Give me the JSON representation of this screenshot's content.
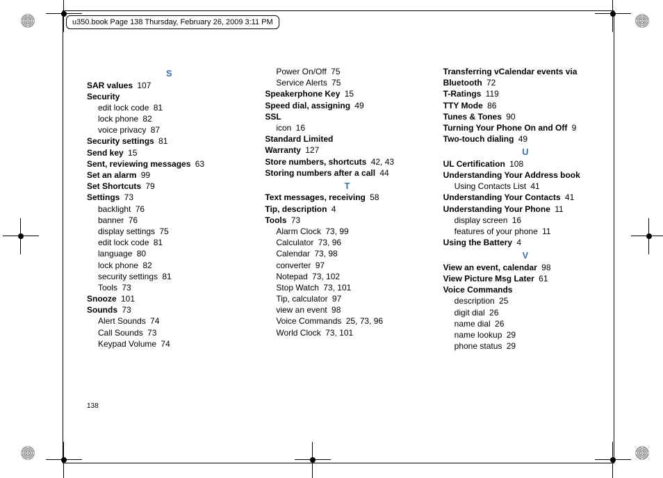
{
  "header_text": "u350.book  Page 138  Thursday, February 26, 2009  3:11 PM",
  "page_number": "138",
  "columns": [
    [
      {
        "type": "letter",
        "text": "S"
      },
      {
        "type": "entry",
        "bold": true,
        "text": "SAR values",
        "pages": "107"
      },
      {
        "type": "entry",
        "bold": true,
        "text": "Security",
        "pages": ""
      },
      {
        "type": "sub",
        "text": "edit lock code",
        "pages": "81"
      },
      {
        "type": "sub",
        "text": "lock phone",
        "pages": "82"
      },
      {
        "type": "sub",
        "text": "voice privacy",
        "pages": "87"
      },
      {
        "type": "entry",
        "bold": true,
        "text": "Security settings",
        "pages": "81"
      },
      {
        "type": "entry",
        "bold": true,
        "text": "Send key",
        "pages": "15"
      },
      {
        "type": "entry",
        "bold": true,
        "text": "Sent, reviewing messages",
        "pages": "63"
      },
      {
        "type": "entry",
        "bold": true,
        "text": "Set an alarm",
        "pages": "99"
      },
      {
        "type": "entry",
        "bold": true,
        "text": "Set Shortcuts",
        "pages": "79"
      },
      {
        "type": "entry",
        "bold": true,
        "text": "Settings",
        "pages": "73"
      },
      {
        "type": "sub",
        "text": "backlight",
        "pages": "76"
      },
      {
        "type": "sub",
        "text": "banner",
        "pages": "76"
      },
      {
        "type": "sub",
        "text": "display settings",
        "pages": "75"
      },
      {
        "type": "sub",
        "text": "edit lock code",
        "pages": "81"
      },
      {
        "type": "sub",
        "text": "language",
        "pages": "80"
      },
      {
        "type": "sub",
        "text": "lock phone",
        "pages": "82"
      },
      {
        "type": "sub",
        "text": "security settings",
        "pages": "81"
      },
      {
        "type": "sub",
        "text": "Tools",
        "pages": "73"
      },
      {
        "type": "entry",
        "bold": true,
        "text": "Snooze",
        "pages": "101"
      },
      {
        "type": "entry",
        "bold": true,
        "text": "Sounds",
        "pages": "73"
      },
      {
        "type": "sub",
        "text": "Alert Sounds",
        "pages": "74"
      },
      {
        "type": "sub",
        "text": "Call Sounds",
        "pages": "73"
      },
      {
        "type": "sub",
        "text": "Keypad Volume",
        "pages": "74"
      }
    ],
    [
      {
        "type": "sub",
        "text": "Power On/Off",
        "pages": "75"
      },
      {
        "type": "sub",
        "text": "Service Alerts",
        "pages": "75"
      },
      {
        "type": "entry",
        "bold": true,
        "text": "Speakerphone Key",
        "pages": "15"
      },
      {
        "type": "entry",
        "bold": true,
        "text": "Speed dial, assigning",
        "pages": "49"
      },
      {
        "type": "entry",
        "bold": true,
        "text": "SSL",
        "pages": ""
      },
      {
        "type": "sub",
        "text": "icon",
        "pages": "16"
      },
      {
        "type": "entry",
        "bold": true,
        "text": "Standard Limited",
        "pages": ""
      },
      {
        "type": "entry",
        "bold": true,
        "text": "Warranty",
        "pages": "127"
      },
      {
        "type": "entry",
        "bold": true,
        "text": "Store numbers, shortcuts",
        "pages": "42, 43"
      },
      {
        "type": "entry",
        "bold": true,
        "text": "Storing numbers after a call",
        "pages": "44"
      },
      {
        "type": "letter",
        "text": "T"
      },
      {
        "type": "entry",
        "bold": true,
        "text": "Text messages, receiving",
        "pages": "58"
      },
      {
        "type": "entry",
        "bold": true,
        "text": "Tip, description",
        "pages": "4"
      },
      {
        "type": "entry",
        "bold": true,
        "text": "Tools",
        "pages": "73"
      },
      {
        "type": "sub",
        "text": "Alarm Clock",
        "pages": "73, 99"
      },
      {
        "type": "sub",
        "text": "Calculator",
        "pages": "73, 96"
      },
      {
        "type": "sub",
        "text": "Calendar",
        "pages": "73, 98"
      },
      {
        "type": "sub",
        "text": "converter",
        "pages": "97"
      },
      {
        "type": "sub",
        "text": "Notepad",
        "pages": "73, 102"
      },
      {
        "type": "sub",
        "text": "Stop Watch",
        "pages": "73, 101"
      },
      {
        "type": "sub",
        "text": "Tip, calculator",
        "pages": "97"
      },
      {
        "type": "sub",
        "text": "view an event",
        "pages": "98"
      },
      {
        "type": "sub",
        "text": "Voice Commands",
        "pages": "25, 73, 96"
      },
      {
        "type": "sub",
        "text": "World Clock",
        "pages": "73, 101"
      }
    ],
    [
      {
        "type": "entry",
        "bold": true,
        "text": "Transferring vCalendar events via",
        "pages": ""
      },
      {
        "type": "entry",
        "bold": true,
        "text": "Bluetooth",
        "pages": "72"
      },
      {
        "type": "entry",
        "bold": true,
        "text": "T-Ratings",
        "pages": "119"
      },
      {
        "type": "entry",
        "bold": true,
        "text": "TTY Mode",
        "pages": "86"
      },
      {
        "type": "entry",
        "bold": true,
        "text": "Tunes & Tones",
        "pages": "90"
      },
      {
        "type": "entry",
        "bold": true,
        "text": "Turning Your Phone On and Off",
        "pages": "9"
      },
      {
        "type": "entry",
        "bold": true,
        "text": "Two-touch dialing",
        "pages": "49"
      },
      {
        "type": "letter",
        "text": "U"
      },
      {
        "type": "entry",
        "bold": true,
        "text": "UL Certification",
        "pages": "108"
      },
      {
        "type": "entry",
        "bold": true,
        "text": "Understanding Your Address book",
        "pages": ""
      },
      {
        "type": "sub",
        "text": "Using Contacts List",
        "pages": "41"
      },
      {
        "type": "entry",
        "bold": true,
        "text": "Understanding Your Contacts",
        "pages": "41"
      },
      {
        "type": "entry",
        "bold": true,
        "text": "Understanding Your Phone",
        "pages": "11"
      },
      {
        "type": "sub",
        "text": "display screen",
        "pages": "16"
      },
      {
        "type": "sub",
        "text": "features of your phone",
        "pages": "11"
      },
      {
        "type": "entry",
        "bold": true,
        "text": "Using the Battery",
        "pages": "4"
      },
      {
        "type": "letter",
        "text": "V"
      },
      {
        "type": "entry",
        "bold": true,
        "text": "View an event, calendar",
        "pages": "98"
      },
      {
        "type": "entry",
        "bold": true,
        "text": "View Picture Msg Later",
        "pages": "61"
      },
      {
        "type": "entry",
        "bold": true,
        "text": "Voice Commands",
        "pages": ""
      },
      {
        "type": "sub",
        "text": "description",
        "pages": "25"
      },
      {
        "type": "sub",
        "text": "digit dial",
        "pages": "26"
      },
      {
        "type": "sub",
        "text": "name dial",
        "pages": "26"
      },
      {
        "type": "sub",
        "text": "name lookup",
        "pages": "29"
      },
      {
        "type": "sub",
        "text": "phone status",
        "pages": "29"
      }
    ]
  ]
}
